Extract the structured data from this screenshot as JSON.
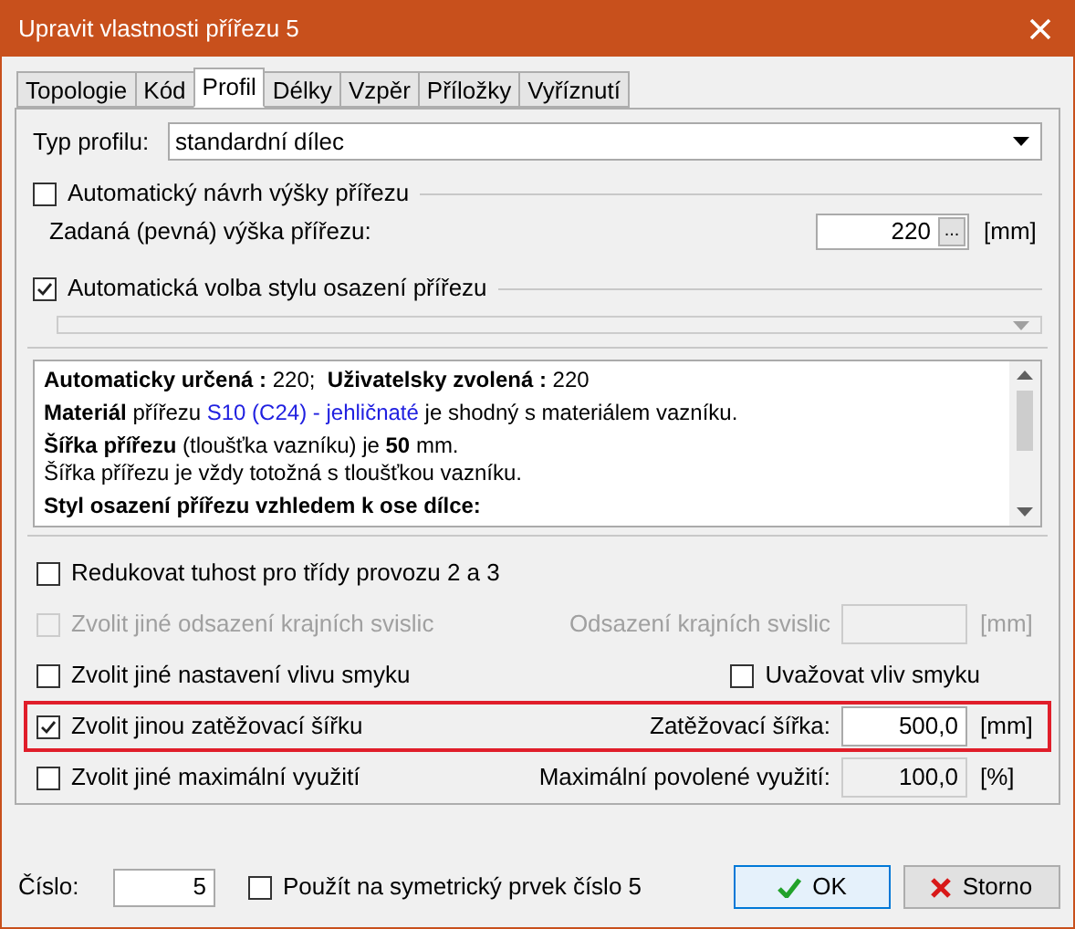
{
  "window": {
    "title": "Upravit vlastnosti přířezu 5"
  },
  "tabs": [
    {
      "label": "Topologie",
      "selected": false
    },
    {
      "label": "Kód",
      "selected": false
    },
    {
      "label": "Profil",
      "selected": true
    },
    {
      "label": "Délky",
      "selected": false
    },
    {
      "label": "Vzpěr",
      "selected": false
    },
    {
      "label": "Příložky",
      "selected": false
    },
    {
      "label": "Vyříznutí",
      "selected": false
    }
  ],
  "profile_type": {
    "label": "Typ profilu:",
    "value": "standardní dílec"
  },
  "auto_height": {
    "label": "Automatický návrh výšky přířezu",
    "checked": false
  },
  "fixed_height": {
    "label": "Zadaná (pevná) výška přířezu:",
    "value": "220",
    "button": "...",
    "unit": "[mm]"
  },
  "auto_style": {
    "label": "Automatická volba stylu osazení přířezu",
    "checked": true
  },
  "info": {
    "paragraphs": [
      [
        {
          "kind": "bold",
          "text": "Automaticky určená :"
        },
        {
          "kind": "normal",
          "text": " 220;  "
        },
        {
          "kind": "bold",
          "text": "Uživatelsky zvolená :"
        },
        {
          "kind": "normal",
          "text": " 220"
        }
      ],
      [
        {
          "kind": "bold",
          "text": "Materiál"
        },
        {
          "kind": "normal",
          "text": " přířezu "
        },
        {
          "kind": "link",
          "text": "S10 (C24) - jehličnaté"
        },
        {
          "kind": "normal",
          "text": " je shodný s materiálem vazníku."
        }
      ],
      [
        {
          "kind": "bold",
          "text": "Šířka přířezu"
        },
        {
          "kind": "normal",
          "text": " (tloušťka vazníku) je "
        },
        {
          "kind": "bold",
          "text": "50"
        },
        {
          "kind": "normal",
          "text": " mm."
        },
        {
          "kind": "break"
        },
        {
          "kind": "normal",
          "text": "Šířka přířezu je vždy totožná s tloušťkou vazníku."
        }
      ],
      [
        {
          "kind": "bold",
          "text": "Styl osazení přířezu vzhledem k ose dílce:"
        }
      ]
    ]
  },
  "options": [
    {
      "label": "Redukovat tuhost pro třídy provozu 2 a 3",
      "checked": false,
      "disabled": false,
      "highlighted": false
    },
    {
      "label": "Zvolit jiné odsazení krajních svislic",
      "checked": false,
      "disabled": true,
      "highlighted": false,
      "field_label": "Odsazení krajních svislic",
      "unit": "[mm]"
    },
    {
      "label": "Zvolit jiné nastavení vlivu smyku",
      "checked": false,
      "disabled": false,
      "highlighted": false,
      "sub_option": {
        "label": "Uvažovat vliv smyku",
        "checked": false
      }
    },
    {
      "label": "Zvolit jinou zatěžovací šířku",
      "checked": true,
      "disabled": false,
      "highlighted": true,
      "field_label": "Zatěžovací šířka:",
      "value": "500,0",
      "unit": "[mm]"
    },
    {
      "label": "Zvolit jiné maximální využití",
      "checked": false,
      "disabled": false,
      "highlighted": false,
      "field_label": "Maximální povolené využití:",
      "value": "100,0",
      "unit": "[%]"
    }
  ],
  "footer": {
    "number_label": "Číslo:",
    "number_value": "5",
    "symmetric": {
      "label": "Použít na symetrický prvek číslo 5",
      "checked": false
    },
    "buttons": [
      {
        "kind": "ok",
        "label": "OK"
      },
      {
        "kind": "cancel",
        "label": "Storno"
      }
    ]
  }
}
